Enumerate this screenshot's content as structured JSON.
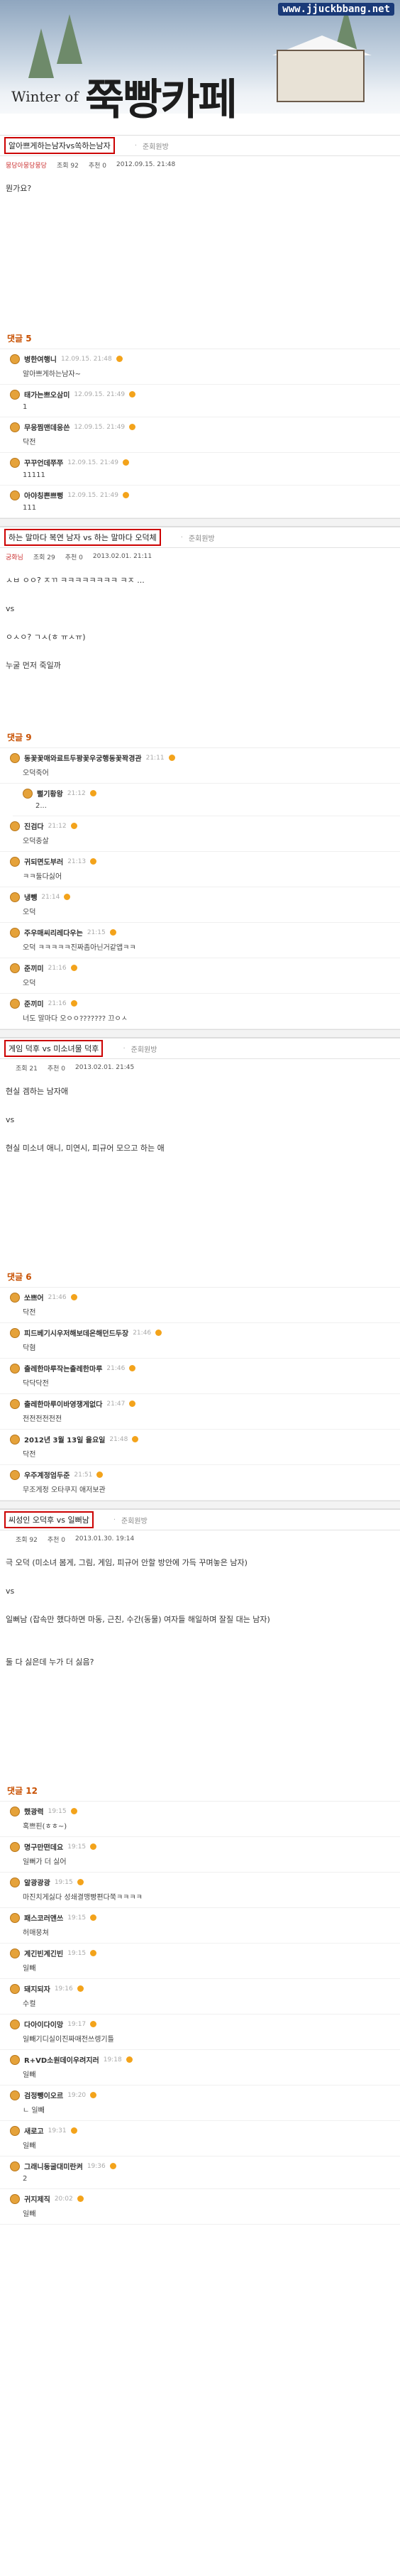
{
  "banner": {
    "url": "www.jjuckbbang.net",
    "winter_text": "Winter of",
    "cafe_title": "쭉빵카페"
  },
  "posts": [
    {
      "title": "알아쁘게하는남자vs쏙하는남자",
      "recommend": "준회원방",
      "writer": "뭉당아뭉당뭉당",
      "views": "조회 92",
      "likes": "추천 0",
      "date": "2012.09.15. 21:48",
      "content": "뭔가요?",
      "comments_label": "댓글 5",
      "comments": [
        {
          "name": "병한여행니",
          "date": "12.09.15. 21:48",
          "text": "알아쁘게하는남자~"
        },
        {
          "name": "태가는쁘오삼미",
          "date": "12.09.15. 21:49",
          "text": "1"
        },
        {
          "name": "무응찜맨데응쓴",
          "date": "12.09.15. 21:49",
          "text": "닥전"
        },
        {
          "name": "꾸꾸언데쭈쭈",
          "date": "12.09.15. 21:49",
          "text": "11111"
        },
        {
          "name": "아야칭쁜쁘뻥",
          "date": "12.09.15. 21:49",
          "text": "111"
        }
      ]
    },
    {
      "title": "하는 말마다 복연 남자 vs 하는 말마다 오덕체",
      "recommend": "준회원방",
      "writer": "궁화님",
      "views": "조회 29",
      "likes": "추천 0",
      "date": "2013.02.01. 21:11",
      "content": "ㅅㅂ ㅇㅇ? ㅈㄲ ㅋㅋㅋㅋㅋㅋㅋㅋ ㅋㅈ ...\n\nvs\n\nㅇㅅㅇ? ㄱㅅ(ㅎ ㅠㅅㅠ)\n\n누굴 먼저 죽일까",
      "comments_label": "댓글 9",
      "comments": [
        {
          "name": "동꽃꽃매와료트두꽝꽃우궁행동꽃꽉경관",
          "date": "21:11",
          "text": "오덕죽어"
        },
        {
          "name": "뻘기황왕",
          "date": "21:12",
          "text": "2...",
          "reply": true
        },
        {
          "name": "진검다",
          "date": "21:12",
          "text": "오덕충살"
        },
        {
          "name": "귀되면도부러",
          "date": "21:13",
          "text": "ㅋㅋ둘다싫어"
        },
        {
          "name": "냉뺑",
          "date": "21:14",
          "text": "오덕"
        },
        {
          "name": "주우매씨리레다우는",
          "date": "21:15",
          "text": "오덕 ㅋㅋㅋㅋㅋ진짜좀아닌거같앱ㅋㅋ"
        },
        {
          "name": "준끼미",
          "date": "21:16",
          "text": "오덕"
        },
        {
          "name": "준끼미",
          "date": "21:16",
          "text": "너도 말마다 오ㅇㅇ??????? 끄ㅇㅅ"
        }
      ]
    },
    {
      "title": "게임 덕후 vs 미소녀물 덕후",
      "recommend": "준회원방",
      "writer": "",
      "views": "조회 21",
      "likes": "추천 0",
      "date": "2013.02.01. 21:45",
      "content": "현실 겜하는 남자애\n\nvs\n\n현실 미소녀 애니, 미연시, 피규어 모으고 하는 애",
      "comments_label": "댓글 6",
      "comments": [
        {
          "name": "쏘쁘어",
          "date": "21:46",
          "text": "닥전"
        },
        {
          "name": "피드베기시우저해보데온해던드두장",
          "date": "21:46",
          "text": "닥혐"
        },
        {
          "name": "출레한마루작는출레한마루",
          "date": "21:46",
          "text": "닥닥닥전"
        },
        {
          "name": "출레한마루이바영쟁게없다",
          "date": "21:47",
          "text": "전전전전전전"
        },
        {
          "name": "2012년 3월 13일 율요일",
          "date": "21:48",
          "text": "닥전"
        },
        {
          "name": "우주계정엄두준",
          "date": "21:51",
          "text": "무조게정 오타쿠지 애저보관"
        }
      ]
    },
    {
      "title": "씨성인 오덕후 vs 일뻐남",
      "recommend": "준회원방",
      "writer": "",
      "views": "조회 92",
      "likes": "추천 0",
      "date": "2013.01.30. 19:14",
      "content": "극 오덕 (미소녀 봄게, 그림, 게임, 피규어 안할 방안에 가득 꾸며놓은 남자)\n\nvs\n\n일뻐남 (잡속만 했다하면 마동, 근친, 수간(동물) 여자들 해일하며 잘질 대는 남자)\n\n\n둘 다 싫은데 누가 더 싫음?",
      "comments_label": "댓글 12",
      "comments": [
        {
          "name": "했광력",
          "date": "19:15",
          "text": "혹쁘핀(ㅎㅎ~)"
        },
        {
          "name": "명구만떤데요",
          "date": "19:15",
          "text": "일뻐가 더 싫어"
        },
        {
          "name": "알광광광",
          "date": "19:15",
          "text": "마진치게싫다 성쇄결맹빵편다쭉ㅋㅋㅋㅋ"
        },
        {
          "name": "패스코러앤쓰",
          "date": "19:15",
          "text": "허매뭉쳐"
        },
        {
          "name": "계긴빈계긴빈",
          "date": "19:15",
          "text": "일빼"
        },
        {
          "name": "돼지되자",
          "date": "19:16",
          "text": "수컬"
        },
        {
          "name": "다아이다이망",
          "date": "19:17",
          "text": "일빼기디실이진짜매전쓰렝기틀"
        },
        {
          "name": "R+VD소원데이우려지러",
          "date": "19:18",
          "text": "일빼"
        },
        {
          "name": "검정뺑이오르",
          "date": "19:20",
          "text": "ㄴ 일빼"
        },
        {
          "name": "새로고",
          "date": "19:31",
          "text": "일빼"
        },
        {
          "name": "그래니동굴대미란켜",
          "date": "19:36",
          "text": "2"
        },
        {
          "name": "귀지제직",
          "date": "20:02",
          "text": "일빼"
        }
      ]
    }
  ]
}
